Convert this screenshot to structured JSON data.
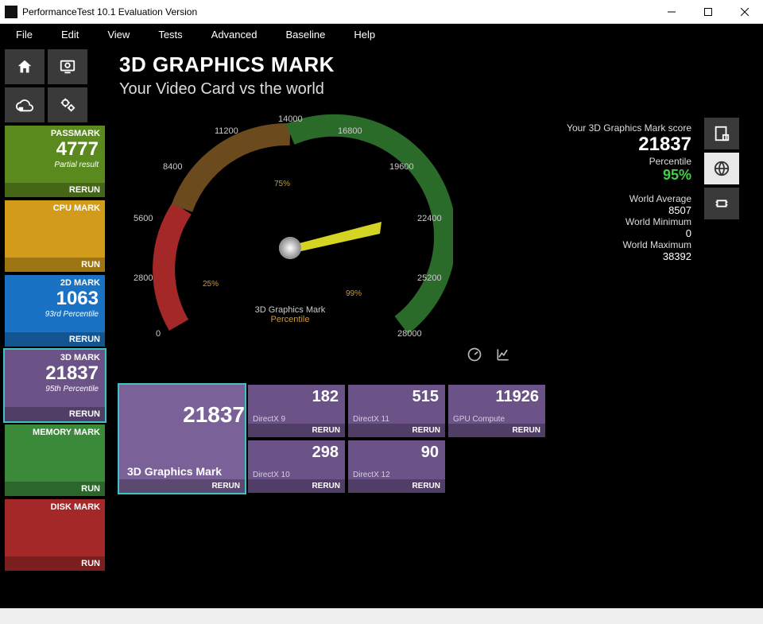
{
  "window": {
    "title": "PerformanceTest 10.1 Evaluation Version"
  },
  "menu": [
    "File",
    "Edit",
    "View",
    "Tests",
    "Advanced",
    "Baseline",
    "Help"
  ],
  "sidebar": {
    "tiles": [
      {
        "label": "PASSMARK",
        "score": "4777",
        "sub": "Partial result",
        "action": "RERUN"
      },
      {
        "label": "CPU MARK",
        "score": "",
        "sub": "",
        "action": "RUN"
      },
      {
        "label": "2D MARK",
        "score": "1063",
        "sub": "93rd Percentile",
        "action": "RERUN"
      },
      {
        "label": "3D MARK",
        "score": "21837",
        "sub": "95th Percentile",
        "action": "RERUN"
      },
      {
        "label": "MEMORY MARK",
        "score": "",
        "sub": "",
        "action": "RUN"
      },
      {
        "label": "DISK MARK",
        "score": "",
        "sub": "",
        "action": "RUN"
      }
    ]
  },
  "header": {
    "title": "3D GRAPHICS MARK",
    "subtitle": "Your Video Card vs the world"
  },
  "gauge": {
    "ticks": [
      "0",
      "2800",
      "5600",
      "8400",
      "11200",
      "14000",
      "16800",
      "19600",
      "22400",
      "25200",
      "28000"
    ],
    "center_label": "3D Graphics Mark",
    "center_sub": "Percentile",
    "p25": "25%",
    "p75": "75%",
    "p99": "99%"
  },
  "stats": {
    "score_label": "Your 3D Graphics Mark score",
    "score": "21837",
    "pct_label": "Percentile",
    "pct": "95%",
    "avg_label": "World Average",
    "avg": "8507",
    "min_label": "World Minimum",
    "min": "0",
    "max_label": "World Maximum",
    "max": "38392"
  },
  "results": {
    "main": {
      "score": "21837",
      "label": "3D Graphics Mark",
      "action": "RERUN"
    },
    "sub": [
      {
        "label": "DirectX 9",
        "score": "182",
        "action": "RERUN"
      },
      {
        "label": "DirectX 10",
        "score": "298",
        "action": "RERUN"
      },
      {
        "label": "DirectX 11",
        "score": "515",
        "action": "RERUN"
      },
      {
        "label": "DirectX 12",
        "score": "90",
        "action": "RERUN"
      },
      {
        "label": "GPU Compute",
        "score": "11926",
        "action": "RERUN"
      }
    ]
  },
  "chart_data": {
    "type": "gauge",
    "title": "3D Graphics Mark",
    "subtitle": "Percentile",
    "range": [
      0,
      28000
    ],
    "ticks": [
      0,
      2800,
      5600,
      8400,
      11200,
      14000,
      16800,
      19600,
      22400,
      25200,
      28000
    ],
    "value": 21837,
    "percentile": 95,
    "zones": [
      {
        "label": "25%",
        "end_value": 2800,
        "color": "#a42828"
      },
      {
        "label": "75%",
        "end_value": 14000,
        "color": "#6b4a1e"
      },
      {
        "label": "99%",
        "end_value": 28000,
        "color": "#2a6b2a"
      }
    ],
    "world": {
      "average": 8507,
      "minimum": 0,
      "maximum": 38392
    }
  }
}
